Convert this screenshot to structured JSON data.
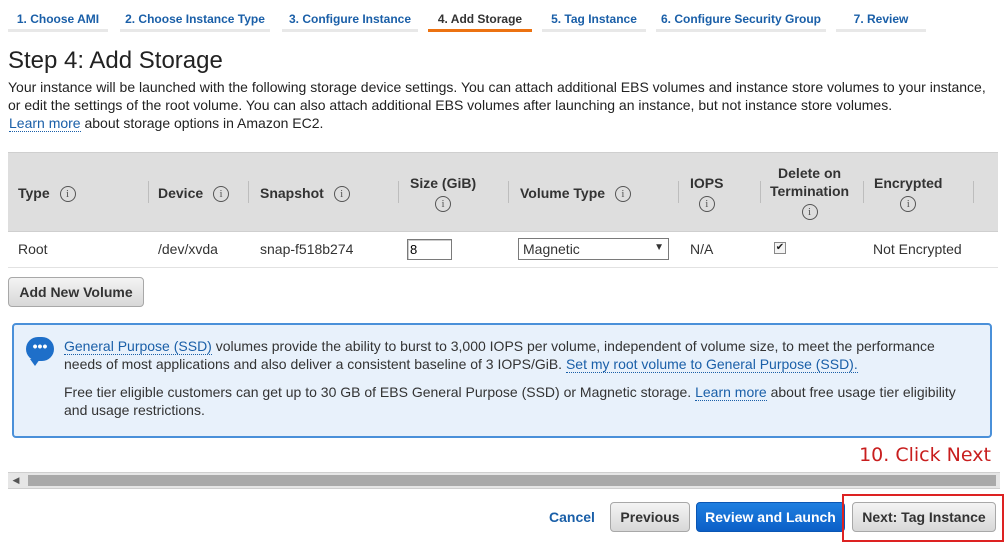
{
  "wizard": {
    "steps": [
      {
        "label": "1. Choose AMI"
      },
      {
        "label": "2. Choose Instance Type"
      },
      {
        "label": "3. Configure Instance"
      },
      {
        "label": "4. Add Storage"
      },
      {
        "label": "5. Tag Instance"
      },
      {
        "label": "6. Configure Security Group"
      },
      {
        "label": "7. Review"
      }
    ],
    "active_step": "4. Add Storage"
  },
  "page": {
    "title": "Step 4: Add Storage",
    "intro": "Your instance will be launched with the following storage device settings. You can attach additional EBS volumes and instance store volumes to your instance, or edit the settings of the root volume. You can also attach additional EBS volumes after launching an instance, but not instance store volumes.",
    "learn_more": "Learn more",
    "intro_suffix": "about storage options in Amazon EC2."
  },
  "table": {
    "columns": [
      "Type",
      "Device",
      "Snapshot",
      "Size (GiB)",
      "Volume Type",
      "IOPS",
      "Delete on Termination",
      "Encrypted"
    ],
    "column_lines": {
      "delete_on_line1": "Delete on",
      "delete_on_line2": "Termination"
    },
    "rows": [
      {
        "type": "Root",
        "device": "/dev/xvda",
        "snapshot": "snap-f518b274",
        "size": "8",
        "volume_type": "Magnetic",
        "iops": "N/A",
        "delete_on_termination": true,
        "encrypted": "Not Encrypted"
      }
    ]
  },
  "add_volume_label": "Add New Volume",
  "banner": {
    "icon": "speech-bubble-icon",
    "link_ssd": "General Purpose (SSD)",
    "text1": "volumes provide the ability to burst to 3,000 IOPS per volume, independent of volume size, to meet the performance needs of most applications and also deliver a consistent baseline of 3 IOPS/GiB.",
    "link_root": "Set my root volume to General Purpose (SSD).",
    "text2": "Free tier eligible customers can get up to 30 GB of EBS General Purpose (SSD) or Magnetic storage.",
    "link_learn": "Learn more",
    "text3": "about free usage tier eligibility and usage restrictions."
  },
  "annotation": "10. Click Next",
  "footer": {
    "cancel": "Cancel",
    "previous": "Previous",
    "review_launch": "Review and Launch",
    "next": "Next: Tag Instance"
  },
  "colors": {
    "accent": "#ec7211",
    "primary_button": "#0b5fc7",
    "link": "#1a5fa8",
    "annotation": "#c81e1e"
  }
}
